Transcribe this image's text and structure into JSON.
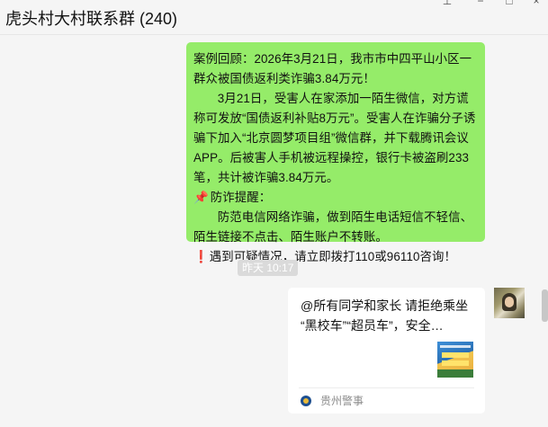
{
  "window": {
    "title": "虎头村大村联系群 (240)"
  },
  "messages": {
    "first": {
      "p1": "案例回顾：2026年3月21日，我市市中四平山小区一群众被国债返利类诈骗3.84万元！",
      "p2": "3月21日，受害人在家添加一陌生微信，对方谎称可发放“国债返利补贴8万元”。受害人在诈骗分子诱骗下加入“北京圆梦项目组”微信群，并下载腾讯会议APP。后被害人手机被远程操控，银行卡被盗刷233笔，共计被诈骗3.84万元。",
      "pin_icon": "📌",
      "p3": "防诈提醒：",
      "p4": "防范电信网络诈骗，做到陌生电话短信不轻信、陌生链接不点击、陌生账户不转账。",
      "alert_icon": "❗",
      "p5": "遇到可疑情况，请立即拨打110或96110咨询！"
    },
    "timestamp": "昨天 10:17",
    "card": {
      "line1": "@所有同学和家长 请拒绝乘坐",
      "line2": "“黑校车”“超员车”，安全…",
      "source": "贵州警事"
    }
  },
  "colors": {
    "bubble_green": "#95ec69",
    "background": "#f5f5f5"
  }
}
